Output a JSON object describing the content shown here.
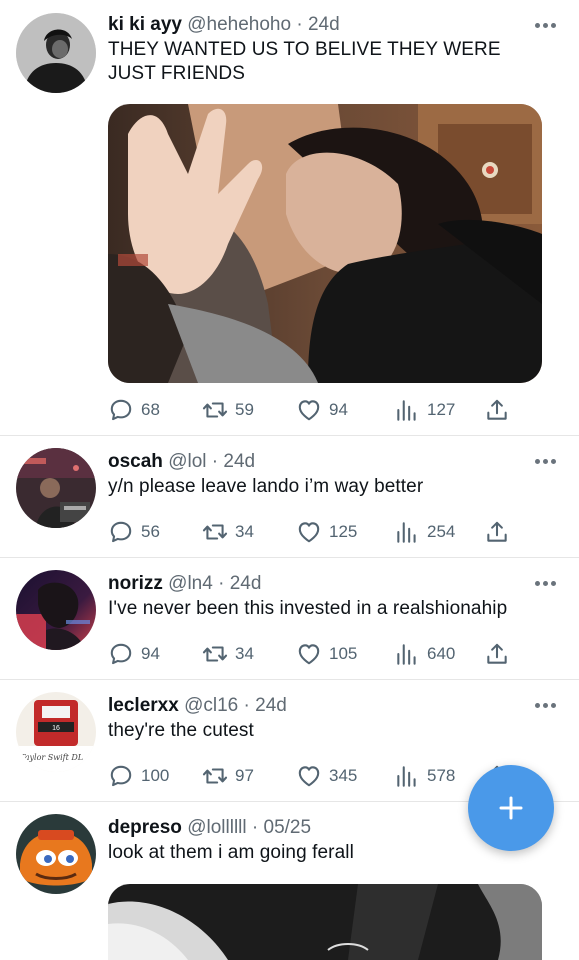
{
  "tweets": [
    {
      "name": "ki ki ayy",
      "handle": "@hehehoho",
      "dot": "·",
      "time": "24d",
      "text": "THEY WANTED US TO BELIVE THEY WERE JUST FRIENDS",
      "replies": "68",
      "retweets": "59",
      "likes": "94",
      "views": "127"
    },
    {
      "name": "oscah",
      "handle": "@lol",
      "dot": "·",
      "time": "24d",
      "text": "y/n please leave lando i’m way better",
      "replies": "56",
      "retweets": "34",
      "likes": "125",
      "views": "254"
    },
    {
      "name": "norizz",
      "handle": "@ln4",
      "dot": "·",
      "time": "24d",
      "text": "I've never been this invested in a realshionahip",
      "replies": "94",
      "retweets": "34",
      "likes": "105",
      "views": "640"
    },
    {
      "name": "leclerxx",
      "handle": "@cl16",
      "dot": "·",
      "time": "24d",
      "text": "they're the cutest",
      "replies": "100",
      "retweets": "97",
      "likes": "345",
      "views": "578"
    },
    {
      "name": "depreso",
      "handle": "@lollllll",
      "dot": "·",
      "time": "05/25",
      "text": "look at them i am going ferall"
    }
  ],
  "avatar_sign_text": "Taylor Swift  DL",
  "colors": {
    "action_gray": "#536471",
    "fab_blue": "#4a99e9",
    "divider": "#e6e6e6"
  },
  "icons": [
    "reply-icon",
    "retweet-icon",
    "like-icon",
    "views-icon",
    "share-icon",
    "more-icon",
    "compose-plus-icon"
  ]
}
